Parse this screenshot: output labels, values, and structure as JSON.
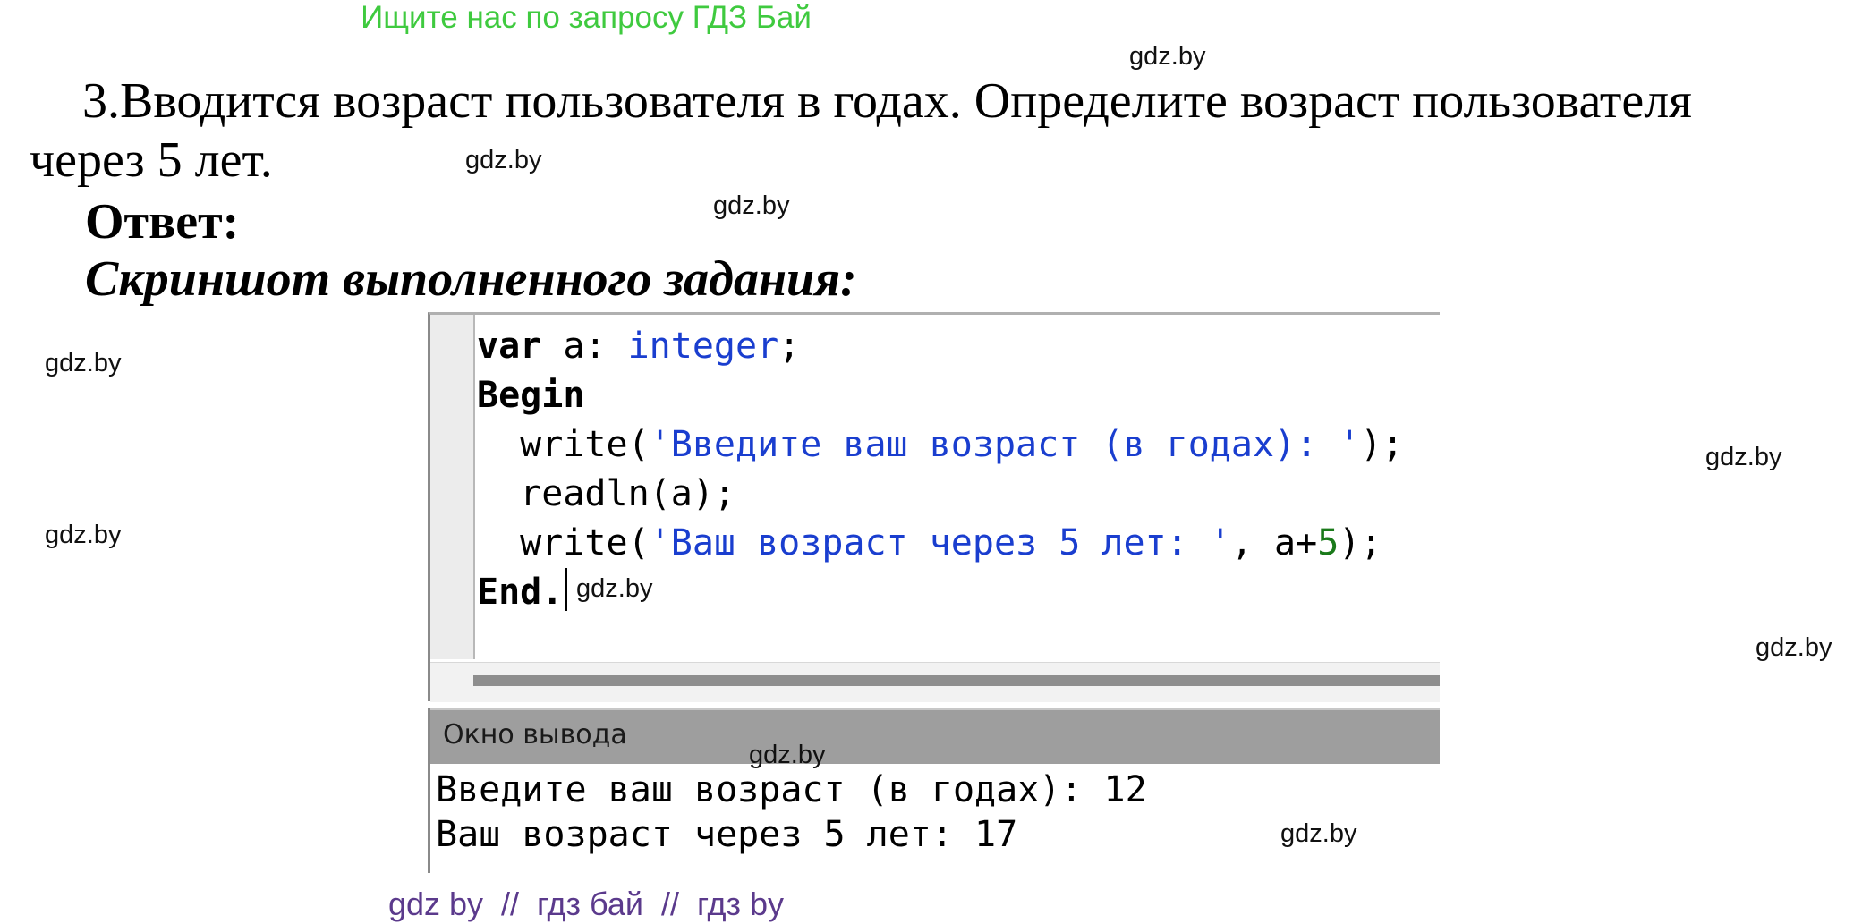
{
  "banner": "Ищите нас по запросу ГДЗ Бай",
  "watermark": "gdz.by",
  "task": {
    "line1": "3.Вводится возраст пользователя в годах. Определите возраст пользователя",
    "line2": "через 5 лет."
  },
  "answer_label": "Ответ:",
  "screenshot_caption": "Скриншот выполненного задания:",
  "editor": {
    "code": {
      "l1": {
        "kw": "var",
        "a": " a: ",
        "type": "integer",
        "b": ";"
      },
      "l2": {
        "kw": "Begin"
      },
      "l3": {
        "a": "  write(",
        "str": "'Введите ваш возраст (в годах): '",
        "b": ");"
      },
      "l4": {
        "a": "  readln(a);"
      },
      "l5": {
        "a": "  write(",
        "str": "'Ваш возраст через 5 лет: '",
        "b": ", a+",
        "num": "5",
        "c": ");"
      },
      "l6": {
        "kw": "End."
      }
    }
  },
  "output_window": {
    "title": "Окно вывода",
    "lines": [
      "Введите ваш возраст (в годах): 12",
      "Ваш возраст через 5 лет: 17"
    ]
  },
  "footer": "gdz by  //  гдз бай  //  гдз by",
  "colors": {
    "banner": "#3fca3f",
    "keyword_type": "#1a3ecf",
    "string": "#1a3ecf",
    "number": "#1a7a1a",
    "footer": "#5b3a8c"
  }
}
